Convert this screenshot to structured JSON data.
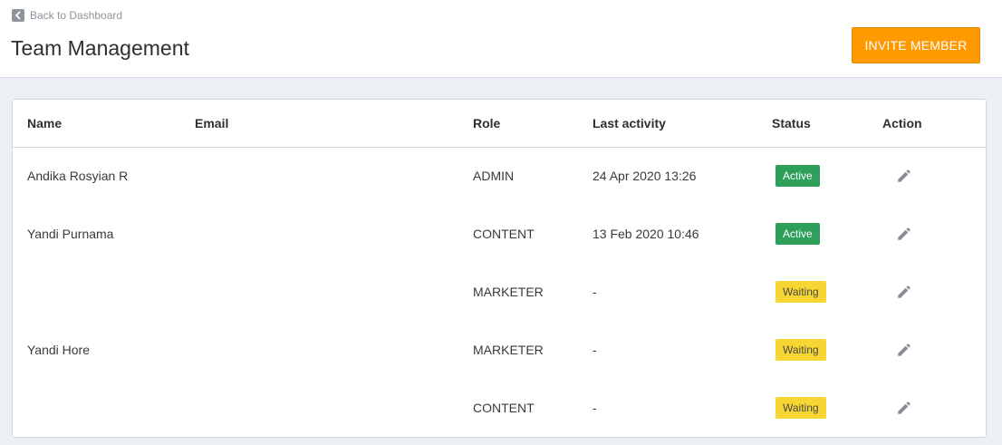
{
  "header": {
    "back_label": "Back to Dashboard",
    "title": "Team Management",
    "invite_label": "INVITE MEMBER"
  },
  "table": {
    "columns": {
      "name": "Name",
      "email": "Email",
      "role": "Role",
      "last_activity": "Last activity",
      "status": "Status",
      "action": "Action"
    },
    "rows": [
      {
        "name": "Andika Rosyian R",
        "email": "",
        "role": "ADMIN",
        "last_activity": "24 Apr 2020 13:26",
        "status": "Active"
      },
      {
        "name": "Yandi Purnama",
        "email": "",
        "role": "CONTENT",
        "last_activity": "13 Feb 2020 10:46",
        "status": "Active"
      },
      {
        "name": "",
        "email": "",
        "role": "MARKETER",
        "last_activity": "-",
        "status": "Waiting"
      },
      {
        "name": "Yandi Hore",
        "email": "",
        "role": "MARKETER",
        "last_activity": "-",
        "status": "Waiting"
      },
      {
        "name": "",
        "email": "",
        "role": "CONTENT",
        "last_activity": "-",
        "status": "Waiting"
      }
    ]
  },
  "colors": {
    "accent": "#ff9900",
    "active": "#2e9e5b",
    "waiting": "#f7d633"
  },
  "icons": {
    "back": "chevron-left-icon",
    "edit": "pencil-icon"
  }
}
